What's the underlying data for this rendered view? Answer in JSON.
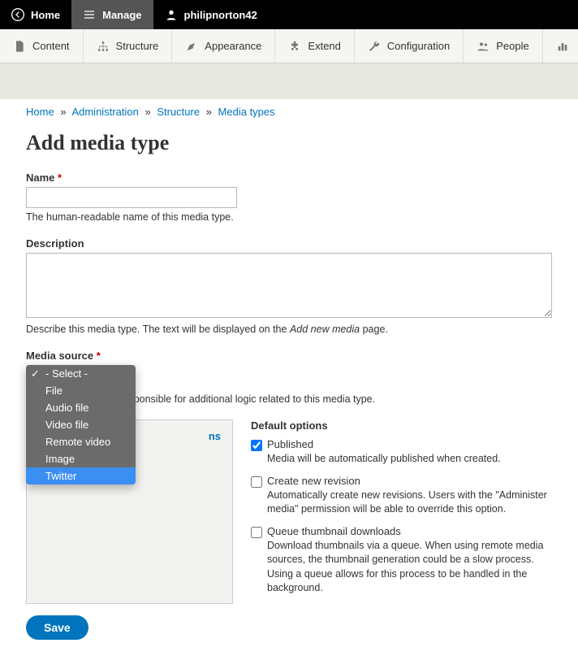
{
  "topbar": {
    "home": "Home",
    "manage": "Manage",
    "user": "philipnorton42"
  },
  "tabs": [
    {
      "id": "content",
      "label": "Content"
    },
    {
      "id": "structure",
      "label": "Structure"
    },
    {
      "id": "appearance",
      "label": "Appearance"
    },
    {
      "id": "extend",
      "label": "Extend"
    },
    {
      "id": "configuration",
      "label": "Configuration"
    },
    {
      "id": "people",
      "label": "People"
    }
  ],
  "breadcrumb": [
    {
      "label": "Home"
    },
    {
      "label": "Administration"
    },
    {
      "label": "Structure"
    },
    {
      "label": "Media types"
    }
  ],
  "page_title": "Add media type",
  "form": {
    "name": {
      "label": "Name",
      "required_marker": "*",
      "value": "",
      "help": "The human-readable name of this media type."
    },
    "description": {
      "label": "Description",
      "value": "",
      "help_prefix": "Describe this media type. The text will be displayed on the ",
      "help_em": "Add new media",
      "help_suffix": " page."
    },
    "media_source": {
      "label": "Media source",
      "required_marker": "*",
      "help": "Media source that is responsible for additional logic related to this media type.",
      "options": [
        {
          "label": "- Select -",
          "selected": true
        },
        {
          "label": "File"
        },
        {
          "label": "Audio file"
        },
        {
          "label": "Video file"
        },
        {
          "label": "Remote video"
        },
        {
          "label": "Image"
        },
        {
          "label": "Twitter",
          "highlighted": true
        }
      ]
    }
  },
  "vertical_tabs": {
    "publishing_label_fragment": "ns"
  },
  "details": {
    "legend": "Default options",
    "checks": [
      {
        "id": "published",
        "label": "Published",
        "checked": true,
        "desc": "Media will be automatically published when created."
      },
      {
        "id": "revision",
        "label": "Create new revision",
        "checked": false,
        "desc": "Automatically create new revisions. Users with the \"Administer media\" permission will be able to override this option."
      },
      {
        "id": "queue",
        "label": "Queue thumbnail downloads",
        "checked": false,
        "desc": "Download thumbnails via a queue. When using remote media sources, the thumbnail generation could be a slow process. Using a queue allows for this process to be handled in the background."
      }
    ]
  },
  "buttons": {
    "save": "Save"
  }
}
